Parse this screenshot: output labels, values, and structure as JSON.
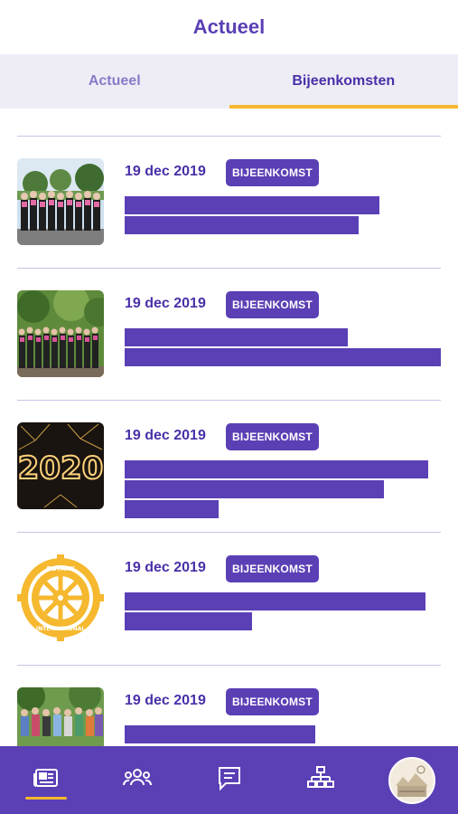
{
  "header": {
    "title": "Actueel"
  },
  "tabs": [
    {
      "label": "Actueel",
      "active": false
    },
    {
      "label": "Bijeenkomsten",
      "active": true
    }
  ],
  "items": [
    {
      "date": "19 dec 2019",
      "badge": "BIJEENKOMST",
      "image": "choir-group-photo"
    },
    {
      "date": "19 dec 2019",
      "badge": "BIJEENKOMST",
      "image": "choir-outdoor-photo"
    },
    {
      "date": "19 dec 2019",
      "badge": "BIJEENKOMST",
      "image": "fireworks-2020-photo"
    },
    {
      "date": "19 dec 2019",
      "badge": "BIJEENKOMST",
      "image": "rotary-international-logo"
    },
    {
      "date": "19 dec 2019",
      "badge": "BIJEENKOMST",
      "image": "group-photo"
    }
  ],
  "logo_text": {
    "rotary": "ROTARY",
    "international": "INTERNATIONAL",
    "year": "2020"
  },
  "nav": {
    "items": [
      "news-icon",
      "members-icon",
      "chat-icon",
      "network-icon",
      "profile-avatar"
    ],
    "active": "news-icon"
  },
  "colors": {
    "primary": "#5B3FB5",
    "accent": "#F5B82E",
    "tab_bg": "#EEEDF6"
  }
}
